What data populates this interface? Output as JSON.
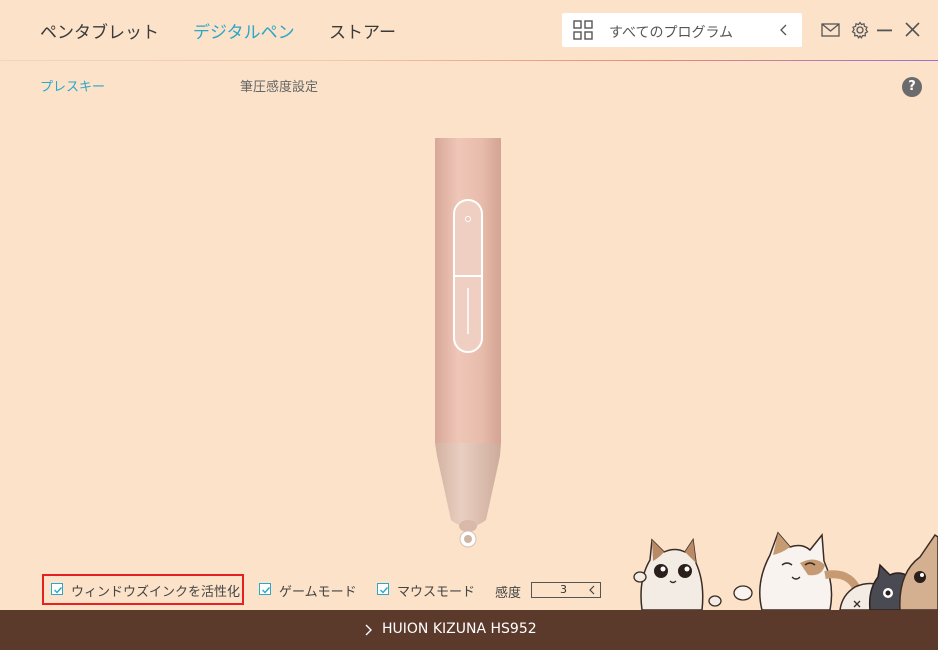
{
  "header": {
    "tabs": [
      {
        "label": "ペンタブレット",
        "active": false
      },
      {
        "label": "デジタルペン",
        "active": true
      },
      {
        "label": "ストアー",
        "active": false
      }
    ],
    "program_select": {
      "value": "すべてのプログラム",
      "icon": "grid-icon"
    },
    "window_icons": [
      "mail-icon",
      "gear-icon",
      "minimize-icon",
      "close-icon"
    ]
  },
  "subtabs": [
    {
      "label": "プレスキー",
      "active": true
    },
    {
      "label": "筆圧感度設定",
      "active": false
    }
  ],
  "help": {
    "label": "?"
  },
  "options": {
    "windows_ink": {
      "label": "ウィンドウズインクを活性化",
      "checked": true
    },
    "game_mode": {
      "label": "ゲームモード",
      "checked": true
    },
    "mouse_mode": {
      "label": "マウスモード",
      "checked": true
    },
    "sensitivity": {
      "label": "感度",
      "value": "3"
    }
  },
  "footer": {
    "device": "HUION KIZUNA HS952"
  },
  "colors": {
    "accent": "#2aa7c9",
    "background": "#fbe2c9",
    "footer": "#5b3a2c",
    "highlight": "#e32120"
  }
}
